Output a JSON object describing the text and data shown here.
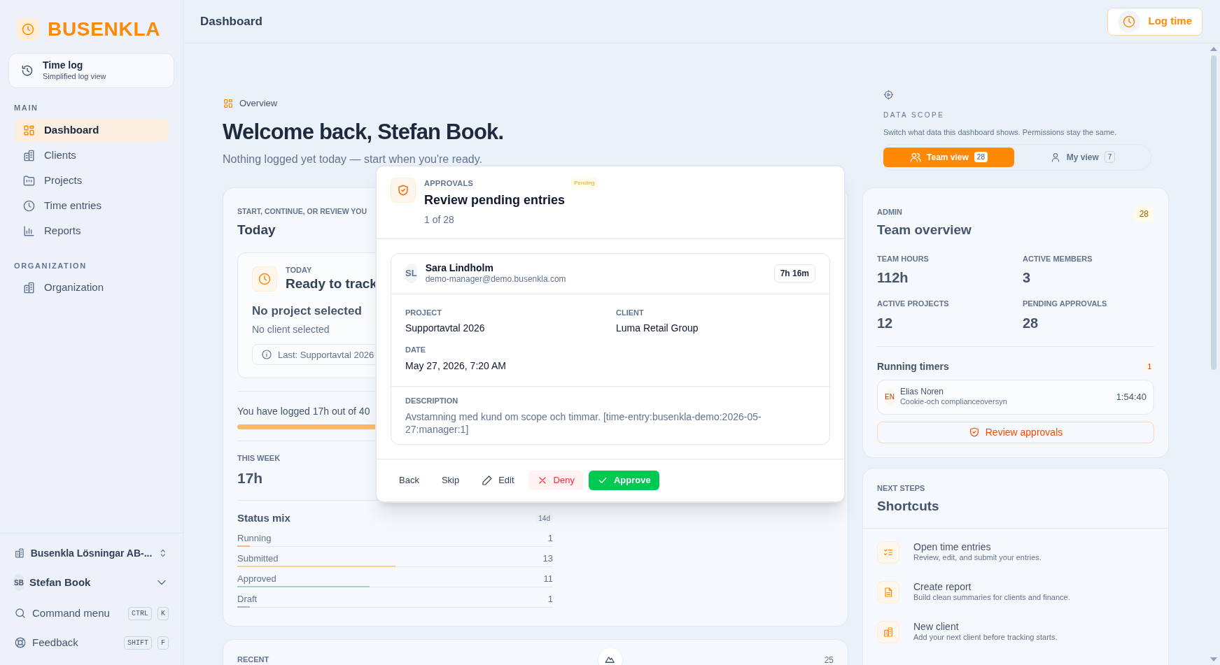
{
  "sidebar": {
    "logo": "BUSENKLA",
    "time_log": {
      "title": "Time log",
      "subtitle": "Simplified log view"
    },
    "sections": [
      {
        "label": "MAIN",
        "items": [
          {
            "label": "Dashboard",
            "selected": true
          },
          {
            "label": "Clients",
            "selected": false
          },
          {
            "label": "Projects",
            "selected": false
          },
          {
            "label": "Time entries",
            "selected": false
          },
          {
            "label": "Reports",
            "selected": false
          }
        ]
      },
      {
        "label": "ORGANIZATION",
        "items": [
          {
            "label": "Organization",
            "selected": false
          }
        ]
      }
    ],
    "workspace": "Busenkla Lösningar AB-...",
    "user": {
      "initials": "SB",
      "name": "Stefan Book"
    },
    "commands": [
      {
        "label": "Command menu",
        "keys": [
          "CTRL",
          "K"
        ]
      },
      {
        "label": "Feedback",
        "keys": [
          "SHIFT",
          "F"
        ]
      }
    ]
  },
  "header": {
    "title": "Dashboard",
    "log_button": "Log time"
  },
  "overview": {
    "breadcrumb": "Overview",
    "heading": "Welcome back, Stefan Book.",
    "subtitle": "Nothing logged yet today — start when you're ready."
  },
  "today_card": {
    "eyebrow": "START, CONTINUE, OR REVIEW YOU",
    "title": "Today",
    "tracker": {
      "eyebrow": "TODAY",
      "title": "Ready to track",
      "project": "No project selected",
      "client": "No client selected",
      "last": "Last: Supportavtal 2026"
    },
    "progress_text": "You have logged 17h out of 40",
    "level": 0.425,
    "week_label": "THIS WEEK",
    "week_value": "17h"
  },
  "status_mix": {
    "title": "Status mix",
    "range": "14d",
    "rows": [
      {
        "label": "Running",
        "value": "1",
        "level": 0.04,
        "color": "#f5b68c"
      },
      {
        "label": "Submitted",
        "value": "13",
        "level": 0.5,
        "color": "#efd58a"
      },
      {
        "label": "Approved",
        "value": "11",
        "level": 0.42,
        "color": "#9fd8c0"
      },
      {
        "label": "Draft",
        "value": "1",
        "level": 0.04,
        "color": "#a9b4c4"
      }
    ]
  },
  "recent": {
    "eyebrow": "RECENT",
    "count": "25"
  },
  "data_scope": {
    "eyebrow": "DATA SCOPE",
    "description": "Switch what data this dashboard shows. Permissions stay the same.",
    "options": [
      {
        "label": "Team view",
        "count": "28",
        "selected": true
      },
      {
        "label": "My view",
        "count": "7",
        "selected": false
      }
    ]
  },
  "team_overview": {
    "eyebrow": "ADMIN",
    "title": "Team overview",
    "badge": "28",
    "stats": [
      {
        "label": "TEAM HOURS",
        "value": "112h"
      },
      {
        "label": "ACTIVE MEMBERS",
        "value": "3"
      },
      {
        "label": "ACTIVE PROJECTS",
        "value": "12"
      },
      {
        "label": "PENDING APPROVALS",
        "value": "28"
      }
    ],
    "timers_title": "Running timers",
    "timers_count": "1",
    "timers": [
      {
        "initials": "EN",
        "name": "Elias Noren",
        "project": "Cookie-och complianceoversyn",
        "elapsed": "1:54:40"
      }
    ],
    "button": "Review approvals"
  },
  "shortcuts": {
    "eyebrow": "NEXT STEPS",
    "title": "Shortcuts",
    "items": [
      {
        "title": "Open time entries",
        "description": "Review, edit, and submit your entries."
      },
      {
        "title": "Create report",
        "description": "Build clean summaries for clients and finance."
      },
      {
        "title": "New client",
        "description": "Add your next client before tracking starts."
      }
    ]
  },
  "modal": {
    "eyebrow": "APPROVALS",
    "status": "Pending",
    "title": "Review pending entries",
    "position": "1 of 28",
    "entry": {
      "initials": "SL",
      "name": "Sara Lindholm",
      "email": "demo-manager@demo.busenkla.com",
      "duration": "7h 16m",
      "fields": [
        {
          "label": "PROJECT",
          "value": "Supportavtal 2026"
        },
        {
          "label": "CLIENT",
          "value": "Luma Retail Group"
        },
        {
          "label": "DATE",
          "value": "May 27, 2026, 7:20 AM"
        }
      ],
      "description_label": "DESCRIPTION",
      "description": "Avstamning med kund om scope och timmar. [time-entry:busenkla-demo:2026-05-27:manager:1]"
    },
    "buttons": [
      {
        "label": "Back",
        "kind": "plain"
      },
      {
        "label": "Skip",
        "kind": "plain"
      },
      {
        "label": "Edit",
        "kind": "edit"
      },
      {
        "label": "Deny",
        "kind": "deny"
      },
      {
        "label": "Approve",
        "kind": "approve"
      }
    ]
  }
}
